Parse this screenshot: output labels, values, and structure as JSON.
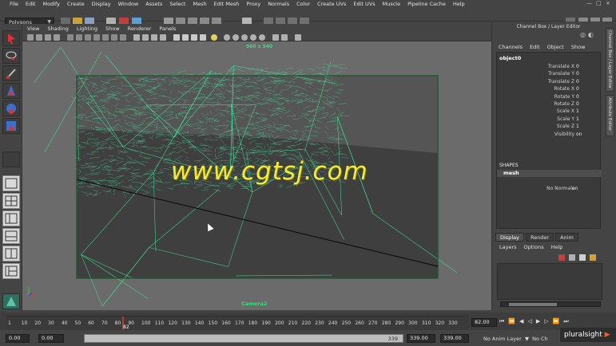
{
  "menubar": {
    "items": [
      "File",
      "Edit",
      "Modify",
      "Create",
      "Display",
      "Window",
      "Assets",
      "Select",
      "Mesh",
      "Edit Mesh",
      "Proxy",
      "Normals",
      "Color",
      "Create UVs",
      "Edit UVs",
      "Muscle",
      "Pipeline Cache",
      "Help"
    ]
  },
  "statusline": {
    "mode": "Polygons"
  },
  "panel": {
    "menu": [
      "View",
      "Shading",
      "Lighting",
      "Show",
      "Renderer",
      "Panels"
    ],
    "resolution": "960 x 540",
    "camera": "Camera2"
  },
  "watermark": "www.cgtsj.com",
  "channel_box": {
    "title": "Channel Box / Layer Editor",
    "menu": [
      "Channels",
      "Edit",
      "Object",
      "Show"
    ],
    "object": "object0",
    "attributes": [
      {
        "label": "Translate X",
        "value": "0"
      },
      {
        "label": "Translate Y",
        "value": "0"
      },
      {
        "label": "Translate Z",
        "value": "0"
      },
      {
        "label": "Rotate X",
        "value": "0"
      },
      {
        "label": "Rotate Y",
        "value": "0"
      },
      {
        "label": "Rotate Z",
        "value": "0"
      },
      {
        "label": "Scale X",
        "value": "1"
      },
      {
        "label": "Scale Y",
        "value": "1"
      },
      {
        "label": "Scale Z",
        "value": "1"
      },
      {
        "label": "Visibility",
        "value": "on"
      }
    ],
    "shapes_label": "SHAPES",
    "shape_name": "mesh",
    "shape_attr": {
      "label": "No Normals",
      "value": "on"
    }
  },
  "side_tabs": [
    "Channel Box / Layer Editor",
    "Attribute Editor"
  ],
  "layer_editor": {
    "tabs": [
      "Display",
      "Render",
      "Anim"
    ],
    "menu": [
      "Layers",
      "Options",
      "Help"
    ]
  },
  "timeline": {
    "ticks": [
      "1",
      "10",
      "20",
      "30",
      "40",
      "50",
      "60",
      "70",
      "80",
      "90",
      "100",
      "110",
      "120",
      "130",
      "140",
      "150",
      "160",
      "170",
      "180",
      "190",
      "200",
      "210",
      "220",
      "230",
      "240",
      "250",
      "260",
      "270",
      "280",
      "290",
      "300",
      "310",
      "320",
      "330"
    ],
    "current_frame": "82",
    "end_field": "82.00"
  },
  "range": {
    "start": "0.00",
    "start2": "0.00",
    "range_value": "339",
    "end": "339.00",
    "end2": "339.00",
    "anim_layer": "No Anim Layer",
    "char_set": "No Ch"
  },
  "branding": {
    "pre": "pluralsight"
  }
}
